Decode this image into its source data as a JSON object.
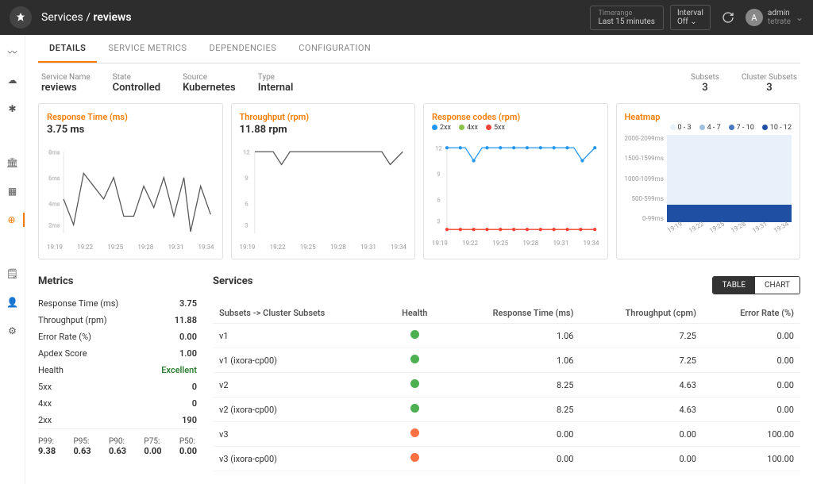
{
  "header": {
    "breadcrumb_parent": "Services",
    "breadcrumb_sep": " / ",
    "breadcrumb_current": "reviews",
    "timerange_label": "Timerange",
    "timerange_value": "Last 15 minutes",
    "interval_label": "Interval",
    "interval_value": "Off",
    "user_initial": "A",
    "user_name": "admin",
    "user_org": "tetrate"
  },
  "tabs": [
    "DETAILS",
    "SERVICE METRICS",
    "DEPENDENCIES",
    "CONFIGURATION"
  ],
  "meta": {
    "service_name_label": "Service Name",
    "service_name": "reviews",
    "state_label": "State",
    "state": "Controlled",
    "source_label": "Source",
    "source": "Kubernetes",
    "type_label": "Type",
    "type": "Internal",
    "subsets_label": "Subsets",
    "subsets": "3",
    "cluster_subsets_label": "Cluster Subsets",
    "cluster_subsets": "3"
  },
  "cards": {
    "rt": {
      "title": "Response Time (ms)",
      "value": "3.75 ms"
    },
    "tp": {
      "title": "Throughput (rpm)",
      "value": "11.88 rpm"
    },
    "rc": {
      "title": "Response codes (rpm)",
      "legend": {
        "l2": "2xx",
        "l4": "4xx",
        "l5": "5xx"
      }
    },
    "hm": {
      "title": "Heatmap",
      "legend": {
        "a": "0 - 3",
        "b": "4 - 7",
        "c": "7 - 10",
        "d": "10 - 12"
      }
    }
  },
  "chart_data": [
    {
      "type": "line",
      "title": "Response Time (ms)",
      "x": [
        "19:19",
        "19:22",
        "19:25",
        "19:28",
        "19:31",
        "19:34"
      ],
      "values": [
        4.0,
        2.0,
        5.5,
        4.5,
        4.0,
        5.0,
        3.0,
        3.0,
        4.5,
        3.5,
        5.0,
        3.0,
        5.0,
        1.0,
        4.5,
        3.0
      ],
      "ylim": [
        0,
        8
      ],
      "yticks": [
        2,
        4,
        6,
        8
      ]
    },
    {
      "type": "line",
      "title": "Throughput (rpm)",
      "x": [
        "19:19",
        "19:22",
        "19:25",
        "19:28",
        "19:31",
        "19:34"
      ],
      "values": [
        12,
        12,
        10,
        12,
        12,
        12,
        12,
        12,
        12,
        12,
        12,
        12,
        12,
        12,
        10,
        12
      ],
      "ylim": [
        0,
        12
      ],
      "yticks": [
        3,
        6,
        9,
        12
      ]
    },
    {
      "type": "line",
      "title": "Response codes (rpm)",
      "x": [
        "19:19",
        "19:22",
        "19:25",
        "19:28",
        "19:31",
        "19:34"
      ],
      "series": [
        {
          "name": "2xx",
          "color": "#2196f3",
          "values": [
            12,
            12,
            12,
            10,
            12,
            12,
            12,
            12,
            12,
            12,
            12,
            12,
            12,
            12,
            10,
            12
          ]
        },
        {
          "name": "4xx",
          "color": "#8bc34a",
          "values": [
            0,
            0,
            0,
            0,
            0,
            0,
            0,
            0,
            0,
            0,
            0,
            0,
            0,
            0,
            0,
            0
          ]
        },
        {
          "name": "5xx",
          "color": "#f44336",
          "values": [
            0,
            0,
            0,
            0,
            0,
            0,
            0,
            0,
            0,
            0,
            0,
            0,
            0,
            0,
            0,
            0
          ]
        }
      ],
      "ylim": [
        0,
        12
      ],
      "yticks": [
        3,
        6,
        9,
        12
      ]
    },
    {
      "type": "heatmap",
      "title": "Heatmap",
      "x": [
        "19:19",
        "19:22",
        "19:25",
        "19:28",
        "19:31",
        "19:34"
      ],
      "y_bins": [
        "0-99ms",
        "500-599ms",
        "1000-1099ms",
        "1500-1599ms",
        "2000-2099ms"
      ],
      "note": "dense band only in 0-99ms row",
      "legend_buckets": [
        "0 - 3",
        "4 - 7",
        "7 - 10",
        "10 - 12"
      ]
    }
  ],
  "x_ticks": {
    "t0": "19:19",
    "t1": "19:22",
    "t2": "19:25",
    "t3": "19:28",
    "t4": "19:31",
    "t5": "19:34"
  },
  "heatmap_y": {
    "y0": "2000-2099ms",
    "y1": "1500-1599ms",
    "y2": "1000-1099ms",
    "y3": "500-599ms",
    "y4": "0-99ms"
  },
  "metrics": {
    "title": "Metrics",
    "rows": {
      "rt_l": "Response Time (ms)",
      "rt_v": "3.75",
      "tp_l": "Throughput (rpm)",
      "tp_v": "11.88",
      "er_l": "Error Rate (%)",
      "er_v": "0.00",
      "ap_l": "Apdex Score",
      "ap_v": "1.00",
      "he_l": "Health",
      "he_v": "Excellent",
      "c5_l": "5xx",
      "c5_v": "0",
      "c4_l": "4xx",
      "c4_v": "0",
      "c2_l": "2xx",
      "c2_v": "190"
    },
    "pcts": {
      "p99_l": "P99:",
      "p99_v": "9.38",
      "p95_l": "P95:",
      "p95_v": "0.63",
      "p90_l": "P90:",
      "p90_v": "0.63",
      "p75_l": "P75:",
      "p75_v": "0.00",
      "p50_l": "P50:",
      "p50_v": "0.00"
    }
  },
  "services": {
    "title": "Services",
    "toggle_table": "TABLE",
    "toggle_chart": "CHART",
    "cols": {
      "c0": "Subsets -> Cluster Subsets",
      "c1": "Health",
      "c2": "Response Time (ms)",
      "c3": "Throughput (cpm)",
      "c4": "Error Rate (%)"
    },
    "rows": [
      {
        "name": "v1",
        "health": "green",
        "rt": "1.06",
        "tp": "7.25",
        "er": "0.00"
      },
      {
        "name": "v1 (ixora-cp00)",
        "health": "green",
        "rt": "1.06",
        "tp": "7.25",
        "er": "0.00"
      },
      {
        "name": "v2",
        "health": "green",
        "rt": "8.25",
        "tp": "4.63",
        "er": "0.00"
      },
      {
        "name": "v2 (ixora-cp00)",
        "health": "green",
        "rt": "8.25",
        "tp": "4.63",
        "er": "0.00"
      },
      {
        "name": "v3",
        "health": "orange",
        "rt": "0.00",
        "tp": "0.00",
        "er": "100.00"
      },
      {
        "name": "v3 (ixora-cp00)",
        "health": "orange",
        "rt": "0.00",
        "tp": "0.00",
        "er": "100.00"
      }
    ]
  }
}
